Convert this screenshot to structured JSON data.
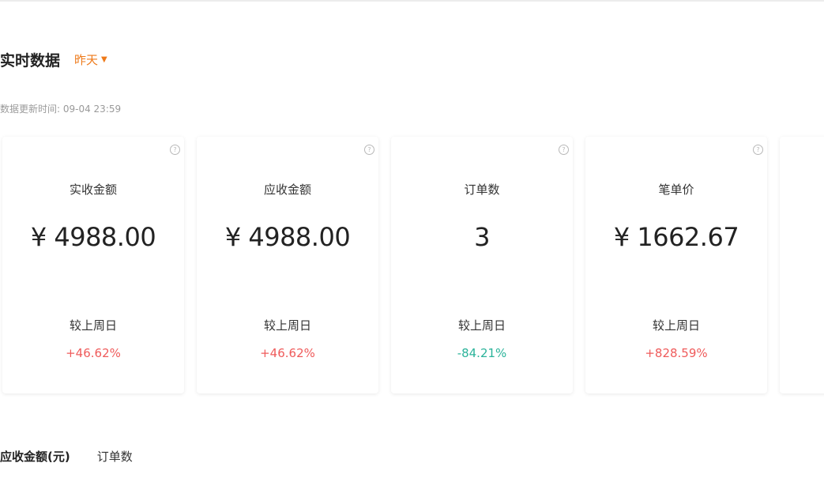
{
  "header": {
    "title": "实时数据",
    "date_selector": "昨天",
    "update_label": "数据更新时间: ",
    "update_time": "09-04 23:59"
  },
  "cards": [
    {
      "name": "实收金额",
      "value": "¥ 4988.00",
      "compare_label": "较上周日",
      "compare_value": "+46.62%",
      "trend": "up"
    },
    {
      "name": "应收金额",
      "value": "¥ 4988.00",
      "compare_label": "较上周日",
      "compare_value": "+46.62%",
      "trend": "up"
    },
    {
      "name": "订单数",
      "value": "3",
      "compare_label": "较上周日",
      "compare_value": "-84.21%",
      "trend": "down"
    },
    {
      "name": "笔单价",
      "value": "¥ 1662.67",
      "compare_label": "较上周日",
      "compare_value": "+828.59%",
      "trend": "up"
    }
  ],
  "tabs": [
    {
      "label": "应收金额(元)",
      "active": true
    },
    {
      "label": "订单数",
      "active": false
    }
  ],
  "colors": {
    "accent": "#ee7a1a",
    "up": "#ef5b5b",
    "down": "#2bb39a"
  },
  "icons": {
    "help": "question-circle-icon",
    "caret": "caret-down-icon"
  }
}
